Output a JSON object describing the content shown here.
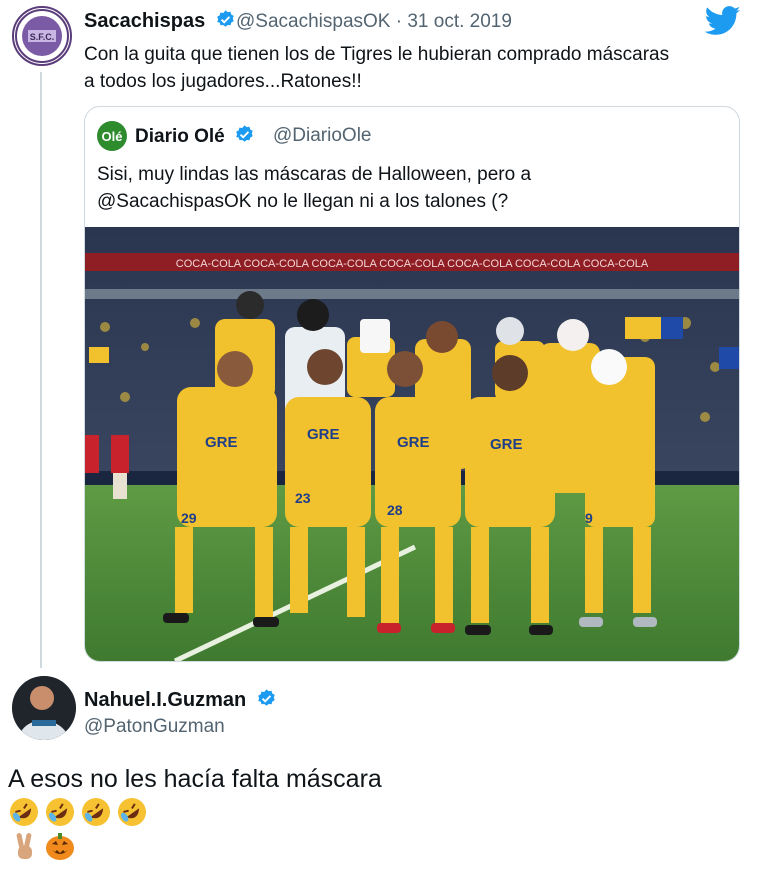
{
  "tweet": {
    "author_name": "Sacachispas",
    "handle": "@SacachispasOK",
    "separator": "·",
    "date": "31 oct. 2019",
    "text_line1": "Con la guita que tienen los de Tigres  le hubieran comprado máscaras",
    "text_line2": "a todos los jugadores...Ratones!!",
    "avatar_initials": "S.F.C."
  },
  "quote": {
    "logo_text": "Olé",
    "author_name": "Diario Olé",
    "handle": "@DiarioOle",
    "text_line1": "Sisi, muy lindas las máscaras de Halloween, pero a",
    "text_line2": "@SacachispasOK no le llegan ni a los talones (?",
    "banner_text": "COCA-COLA  COCA-COLA  COCA-COLA  COCA-COLA  COCA-COLA  COCA-COLA  COCA-COLA",
    "jersey_sponsor": "GRE",
    "numbers": [
      "29",
      "23",
      "28",
      "9"
    ]
  },
  "reply": {
    "author_name": "Nahuel.I.Guzman",
    "handle": "@PatonGuzman",
    "text": "A esos no les hacía falta máscara"
  },
  "colors": {
    "brand_blue": "#1d9bf0",
    "verified": "#1d9bf0",
    "jersey_yellow": "#f2c12e",
    "pitch_green": "#4f8a3a"
  },
  "icons": {
    "bird": "twitter-bird-icon",
    "verified": "verified-badge-icon",
    "emoji_laugh": "rolling-on-floor-laughing-emoji",
    "emoji_peace": "victory-hand-emoji",
    "emoji_pumpkin": "jack-o-lantern-emoji"
  }
}
